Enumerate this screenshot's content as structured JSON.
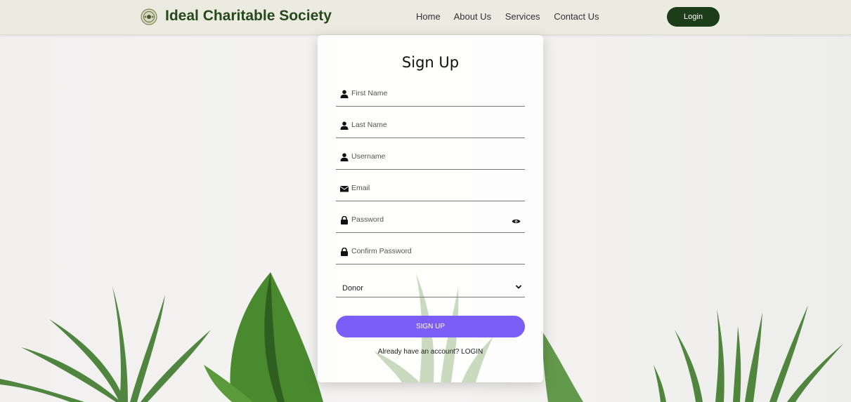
{
  "header": {
    "brand": "Ideal Charitable Society",
    "nav": [
      "Home",
      "About Us",
      "Services",
      "Contact Us"
    ],
    "login_label": "Login"
  },
  "form": {
    "title": "Sign Up",
    "fields": [
      {
        "placeholder": "First Name",
        "icon": "user-icon"
      },
      {
        "placeholder": "Last Name",
        "icon": "user-icon"
      },
      {
        "placeholder": "Username",
        "icon": "user-icon"
      },
      {
        "placeholder": "Email",
        "icon": "envelope-icon"
      },
      {
        "placeholder": "Password",
        "icon": "lock-icon"
      },
      {
        "placeholder": "Confirm Password",
        "icon": "lock-icon"
      }
    ],
    "role_selected": "Donor",
    "submit_label": "SIGN UP",
    "login_prompt": "Already have an account? LOGIN"
  },
  "colors": {
    "nav_bg": "#ecebe1",
    "brand": "#26481d",
    "login_button": "#1c3d18",
    "signup_button": "#7a5ef5"
  }
}
